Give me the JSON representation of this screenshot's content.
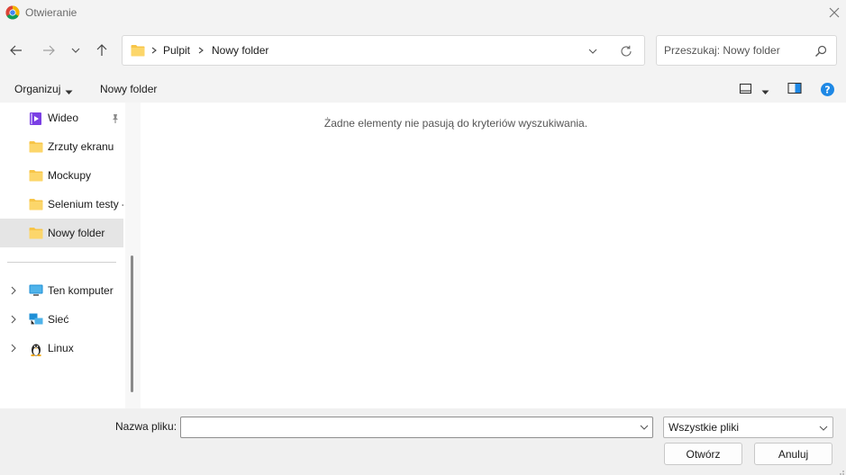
{
  "window": {
    "title": "Otwieranie",
    "app_icon": "chrome-icon"
  },
  "address": {
    "breadcrumbs": [
      "Pulpit",
      "Nowy folder"
    ]
  },
  "search": {
    "placeholder": "Przeszukaj: Nowy folder"
  },
  "toolbar": {
    "organize_label": "Organizuj",
    "new_folder_label": "Nowy folder"
  },
  "sidebar": {
    "items": [
      {
        "label": "Wideo",
        "icon": "video-folder-icon",
        "pinned": true
      },
      {
        "label": "Zrzuty ekranu",
        "icon": "folder-icon"
      },
      {
        "label": "Mockupy",
        "icon": "folder-icon"
      },
      {
        "label": "Selenium testy -",
        "icon": "folder-icon"
      },
      {
        "label": "Nowy folder",
        "icon": "folder-icon",
        "selected": true
      },
      {
        "label": "Ten komputer",
        "icon": "computer-icon"
      },
      {
        "label": "Sieć",
        "icon": "network-icon"
      },
      {
        "label": "Linux",
        "icon": "linux-icon"
      }
    ]
  },
  "main": {
    "empty_message": "Żadne elementy nie pasują do kryteriów wyszukiwania."
  },
  "footer": {
    "filename_label": "Nazwa pliku:",
    "filename_value": "",
    "filetype_selected": "Wszystkie pliki",
    "open_label": "Otwórz",
    "cancel_label": "Anuluj"
  },
  "colors": {
    "folder": "#f7c548",
    "accent": "#0067c0",
    "selected_bg": "#e5e5e5"
  }
}
